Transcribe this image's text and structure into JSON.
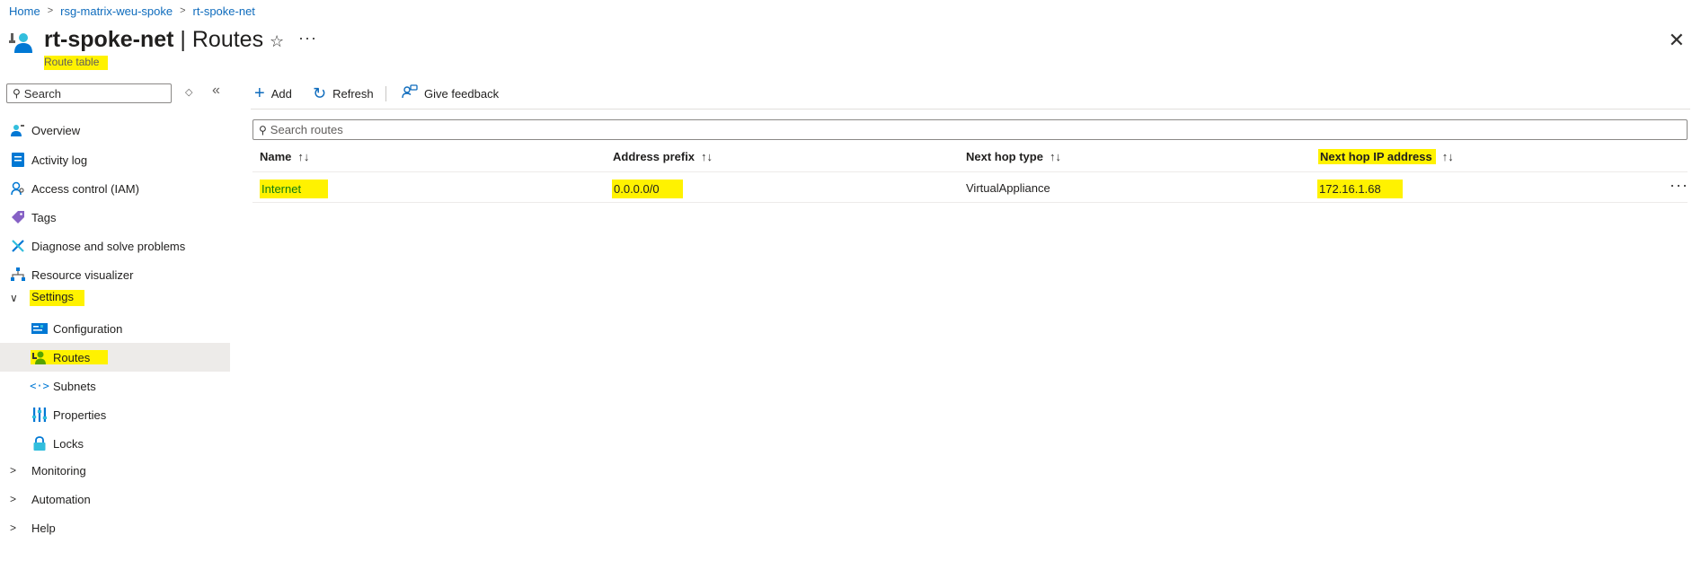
{
  "breadcrumb": {
    "items": [
      "Home",
      "rsg-matrix-weu-spoke",
      "rt-spoke-net"
    ]
  },
  "header": {
    "resource_name": "rt-spoke-net",
    "separator": " | ",
    "page_name": "Routes",
    "subtitle": "Route table"
  },
  "sidebar": {
    "search_placeholder": "Search",
    "items": [
      {
        "label": "Overview",
        "icon": "overview-icon"
      },
      {
        "label": "Activity log",
        "icon": "activity-log-icon"
      },
      {
        "label": "Access control (IAM)",
        "icon": "iam-icon"
      },
      {
        "label": "Tags",
        "icon": "tag-icon"
      },
      {
        "label": "Diagnose and solve problems",
        "icon": "wrench-icon"
      },
      {
        "label": "Resource visualizer",
        "icon": "visualizer-icon"
      },
      {
        "label": "Settings",
        "icon": "chevron-down-icon",
        "expanded": true
      },
      {
        "label": "Configuration",
        "icon": "configuration-icon"
      },
      {
        "label": "Routes",
        "icon": "routes-icon",
        "selected": true
      },
      {
        "label": "Subnets",
        "icon": "subnets-icon"
      },
      {
        "label": "Properties",
        "icon": "properties-icon"
      },
      {
        "label": "Locks",
        "icon": "lock-icon"
      },
      {
        "label": "Monitoring",
        "icon": "chevron-right-icon",
        "expanded": false
      },
      {
        "label": "Automation",
        "icon": "chevron-right-icon",
        "expanded": false
      },
      {
        "label": "Help",
        "icon": "chevron-right-icon",
        "expanded": false
      }
    ]
  },
  "toolbar": {
    "add_label": "Add",
    "refresh_label": "Refresh",
    "feedback_label": "Give feedback"
  },
  "routes": {
    "search_placeholder": "Search routes",
    "columns": [
      "Name",
      "Address prefix",
      "Next hop type",
      "Next hop IP address"
    ],
    "rows": [
      {
        "name": "Internet",
        "address_prefix": "0.0.0.0/0",
        "next_hop_type": "VirtualAppliance",
        "next_hop_ip": "172.16.1.68"
      }
    ]
  },
  "colors": {
    "accent": "#0f6cbd",
    "highlight": "#fff200",
    "selected_bg": "#edebe9"
  }
}
